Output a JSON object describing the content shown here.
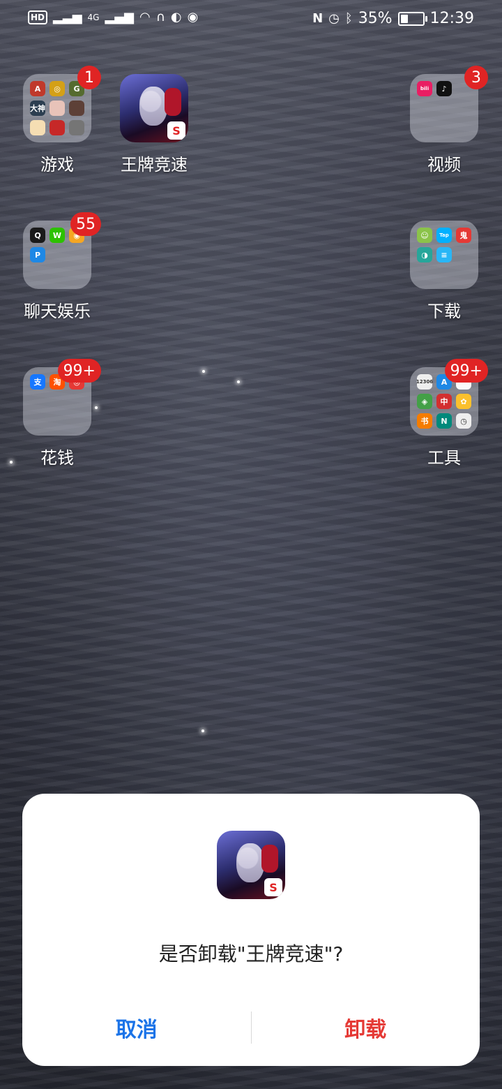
{
  "status_bar": {
    "hd_label": "HD",
    "network": "4G",
    "battery_percent": "35%",
    "battery_level": 0.35,
    "time": "12:39",
    "left_icons": [
      "hd-icon",
      "signal-icon",
      "signal-icon",
      "wifi-icon",
      "headset-icon",
      "data-saver-icon",
      "eye-icon"
    ],
    "right_icons": [
      "nfc-icon",
      "alarm-icon",
      "bluetooth-icon",
      "battery-icon"
    ]
  },
  "apps": [
    {
      "name": "游戏",
      "type": "folder",
      "badge": "1",
      "minis": [
        [
          "#c0392b",
          "A"
        ],
        [
          "#d4a017",
          "◎"
        ],
        [
          "#556b2f",
          "G"
        ],
        [
          "#2c3e50",
          "大神"
        ],
        [
          "#e8c3b9",
          ""
        ],
        [
          "#5d4037",
          ""
        ],
        [
          "#f5deb3",
          ""
        ],
        [
          "#c62828",
          ""
        ],
        [
          "#757575",
          ""
        ]
      ]
    },
    {
      "name": "王牌竞速",
      "type": "game",
      "badge": ""
    },
    {
      "name": "视频",
      "type": "folder",
      "badge": "3",
      "minis": [
        [
          "#e91e63",
          "bili"
        ],
        [
          "#111",
          "♪"
        ]
      ]
    },
    {
      "name": "聊天娱乐",
      "type": "folder",
      "badge": "55",
      "minis": [
        [
          "#1a1a1a",
          "Q"
        ],
        [
          "#2dc100",
          "W"
        ],
        [
          "#f5a623",
          "◉"
        ],
        [
          "#1e88e5",
          "P"
        ]
      ]
    },
    {
      "name": "下载",
      "type": "folder",
      "badge": "",
      "minis": [
        [
          "#8bc34a",
          "☺"
        ],
        [
          "#00b0ff",
          "Tap"
        ],
        [
          "#e53935",
          "鬼"
        ],
        [
          "#26a69a",
          "◑"
        ],
        [
          "#29b6f6",
          "≡"
        ]
      ]
    },
    {
      "name": "花钱",
      "type": "folder",
      "badge": "99+",
      "minis": [
        [
          "#1677ff",
          "支"
        ],
        [
          "#ff5000",
          "淘"
        ],
        [
          "#e53935",
          "◎"
        ]
      ]
    },
    {
      "name": "工具",
      "type": "folder",
      "badge": "99+",
      "minis": [
        [
          "#eeeeee",
          "12306"
        ],
        [
          "#1e88e5",
          "A"
        ],
        [
          "#fafafa",
          ""
        ],
        [
          "#43a047",
          "◈"
        ],
        [
          "#d32f2f",
          "中"
        ],
        [
          "#fbc02d",
          "✿"
        ],
        [
          "#f57c00",
          "书"
        ],
        [
          "#00897b",
          "N"
        ],
        [
          "#eeeeee",
          "◷"
        ]
      ]
    }
  ],
  "dialog": {
    "app_name": "王牌竞速",
    "message": "是否卸载\"王牌竞速\"?",
    "cancel_label": "取消",
    "uninstall_label": "卸载",
    "cancel_color": "#1a73e8",
    "uninstall_color": "#e53935"
  }
}
